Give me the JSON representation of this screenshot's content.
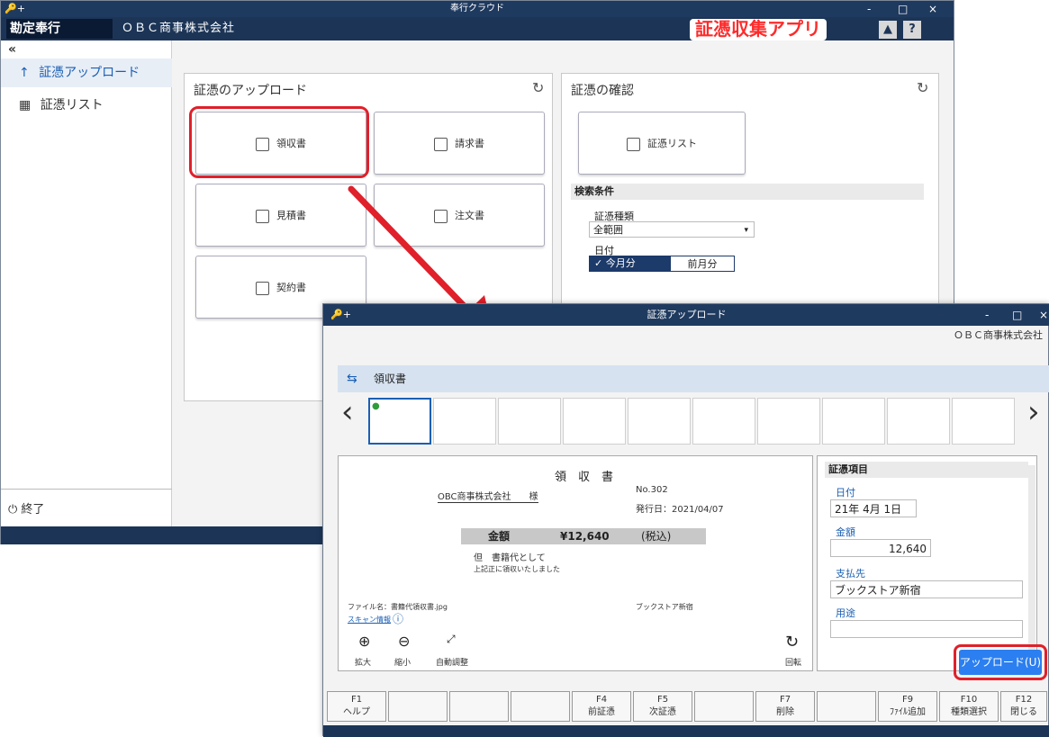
{
  "main": {
    "window_title": "奉行クラウド",
    "controls": {
      "min": "-",
      "max": "□",
      "close": "×"
    },
    "search_icon_text": "🔑+",
    "brand": "勘定奉行",
    "company": "ＯＢＣ商事株式会社",
    "app_badge": "証憑収集アプリ",
    "sidebar": {
      "collapse": "«",
      "items": [
        {
          "icon": "↑",
          "label": "証憑アップロード"
        },
        {
          "icon": "▦",
          "label": "証憑リスト"
        }
      ],
      "exit": "⏻ 終了"
    },
    "upload_panel": {
      "title": "証憑のアップロード",
      "buttons": [
        "領収書",
        "請求書",
        "見積書",
        "注文書",
        "契約書"
      ]
    },
    "confirm_panel": {
      "title": "証憑の確認",
      "list_button": "証憑リスト",
      "search_title": "検索条件",
      "type_label": "証憑種類",
      "type_value": "全範囲",
      "date_label": "日付",
      "date_options": [
        "✓ 今月分",
        "前月分"
      ]
    }
  },
  "upload": {
    "title": "証憑アップロード",
    "company": "ＯＢＣ商事株式会社",
    "doc_type": "領収書",
    "preview": {
      "heading": "領　収　書",
      "to": "OBC商事株式会社　　様",
      "no": "No.302",
      "date": "発行日：2021/04/07",
      "amount_label": "金額",
      "amount_value": "¥12,640",
      "tax": "(税込)",
      "memo": "但　書籍代として",
      "received": "上記正に領収いたしました",
      "file_name": "ファイル名：書籍代領収書.jpg",
      "scan_info": "スキャン情報",
      "shop": "ブックストア新宿",
      "zoom_in": "拡大",
      "zoom_out": "縮小",
      "auto_adjust": "自動調整",
      "rotate": "回転"
    },
    "side": {
      "title": "証憑項目",
      "date_label": "日付",
      "date_value": "21年 4月 1日",
      "amount_label": "金額",
      "amount_value": "12,640",
      "payee_label": "支払先",
      "payee_value": "ブックストア新宿",
      "purpose_label": "用途"
    },
    "upload_button": "アップロード(U)",
    "fkeys": [
      {
        "key": "F1",
        "label": "ヘルプ"
      },
      {
        "key": "",
        "label": ""
      },
      {
        "key": "",
        "label": ""
      },
      {
        "key": "",
        "label": ""
      },
      {
        "key": "F4",
        "label": "前証憑"
      },
      {
        "key": "F5",
        "label": "次証憑"
      },
      {
        "key": "",
        "label": ""
      },
      {
        "key": "F7",
        "label": "削除"
      },
      {
        "key": "",
        "label": ""
      },
      {
        "key": "F9",
        "label": "ﾌｧｲﾙ追加"
      },
      {
        "key": "F10",
        "label": "種類選択"
      },
      {
        "key": "",
        "label": ""
      },
      {
        "key": "F12",
        "label": "閉じる"
      }
    ]
  },
  "colors": {
    "accent": "#e0202a",
    "titlebar": "#1f3a5f",
    "upload_button": "#2b7ff0"
  }
}
